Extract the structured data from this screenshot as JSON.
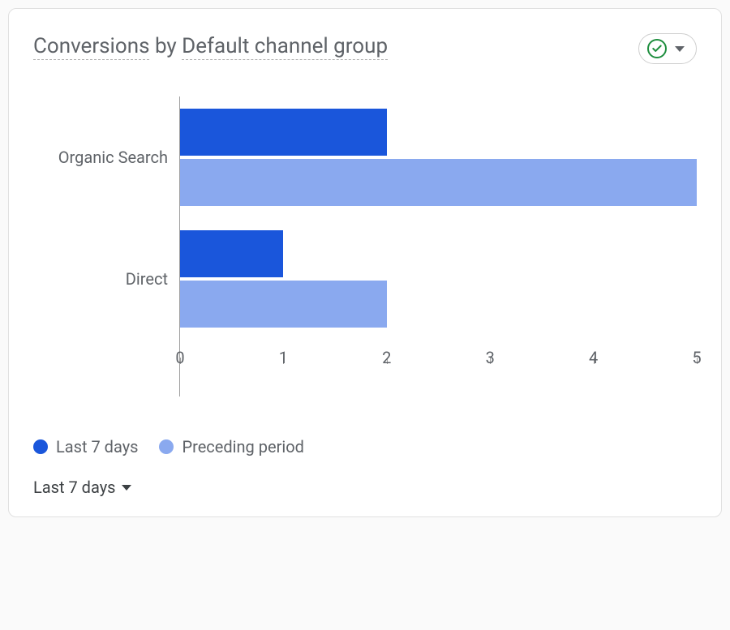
{
  "header": {
    "title_metric": "Conversions",
    "title_by": "by",
    "title_dimension": "Default channel group"
  },
  "legend": {
    "series_a": "Last 7 days",
    "series_b": "Preceding period"
  },
  "range_selector": {
    "label": "Last 7 days"
  },
  "xticks": [
    "0",
    "1",
    "2",
    "3",
    "4",
    "5"
  ],
  "chart_data": {
    "type": "bar",
    "orientation": "horizontal",
    "categories": [
      "Organic Search",
      "Direct"
    ],
    "series": [
      {
        "name": "Last 7 days",
        "values": [
          2,
          1
        ],
        "color": "#1a56db"
      },
      {
        "name": "Preceding period",
        "values": [
          5,
          2
        ],
        "color": "#8aa9ef"
      }
    ],
    "xlabel": "",
    "ylabel": "",
    "xlim": [
      0,
      5
    ]
  }
}
